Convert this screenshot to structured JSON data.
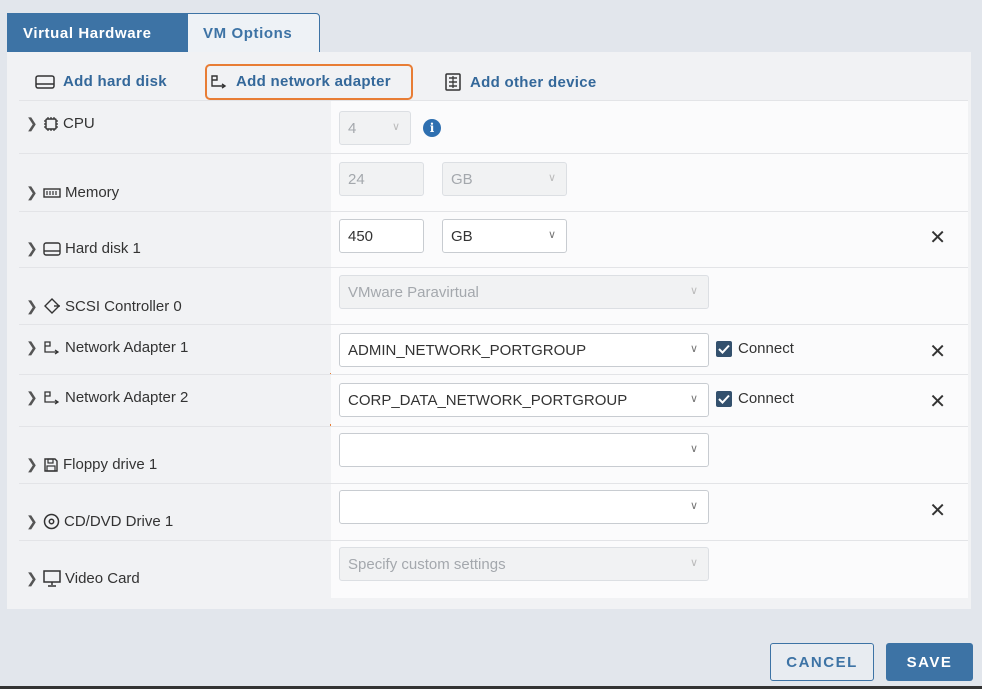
{
  "tabs": {
    "virtual_hardware": "Virtual Hardware",
    "vm_options": "VM Options"
  },
  "toolbar": {
    "add_hard_disk": "Add hard disk",
    "add_network_adapter": "Add network adapter",
    "add_other_device": "Add other device"
  },
  "rows": {
    "cpu": {
      "label": "CPU",
      "value": "4"
    },
    "memory": {
      "label": "Memory",
      "value": "24",
      "unit": "GB"
    },
    "hard_disk": {
      "label": "Hard disk 1",
      "value": "450",
      "unit": "GB"
    },
    "scsi": {
      "label": "SCSI Controller 0",
      "value": "VMware Paravirtual"
    },
    "net1": {
      "label": "Network Adapter 1",
      "value": "ADMIN_NETWORK_PORTGROUP",
      "connect": "Connect"
    },
    "net2": {
      "label": "Network Adapter 2",
      "value": "CORP_DATA_NETWORK_PORTGROUP",
      "connect": "Connect"
    },
    "floppy": {
      "label": "Floppy drive 1",
      "value": ""
    },
    "cddvd": {
      "label": "CD/DVD Drive 1",
      "value": ""
    },
    "video": {
      "label": "Video Card",
      "value": "Specify custom settings"
    }
  },
  "buttons": {
    "cancel": "CANCEL",
    "save": "SAVE"
  },
  "icons": {
    "cpu": "chip-icon",
    "memory": "memory-icon",
    "disk": "hard-disk-icon",
    "scsi": "scsi-icon",
    "network": "network-adapter-icon",
    "floppy": "floppy-icon",
    "cd": "cd-dvd-icon",
    "video": "monitor-icon",
    "info": "info-icon",
    "close": "close-icon"
  },
  "colors": {
    "accent": "#3d73a5",
    "highlight": "#e87d35"
  }
}
